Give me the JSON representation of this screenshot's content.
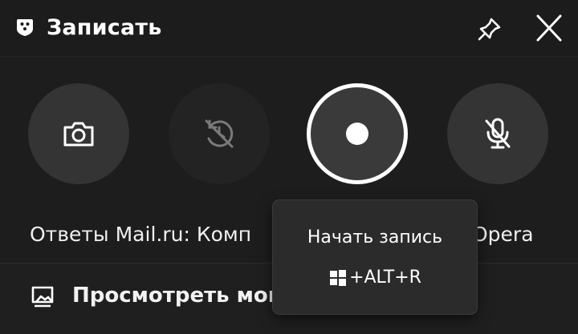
{
  "header": {
    "title": "Записать",
    "app_icon": "capture-widget-icon",
    "pin_icon": "pin-icon",
    "close_icon": "close-icon"
  },
  "controls": [
    {
      "name": "screenshot",
      "icon": "camera-icon"
    },
    {
      "name": "record-last-30",
      "icon": "record-last-icon",
      "disabled": true
    },
    {
      "name": "start-recording",
      "icon": "record-dot-icon"
    },
    {
      "name": "microphone",
      "icon": "mic-off-icon"
    }
  ],
  "status": {
    "left_text": "Ответы Mail.ru: Комп",
    "right_text": "Opera"
  },
  "footer": {
    "gallery_label": "Просмотреть мои",
    "gallery_icon": "gallery-icon"
  },
  "tooltip": {
    "title": "Начать запись",
    "shortcut": "+ALT+R",
    "shortcut_icon": "windows-logo-icon"
  },
  "colors": {
    "background": "#1d1d1d",
    "button": "#343434",
    "accent": "#ffffff"
  }
}
